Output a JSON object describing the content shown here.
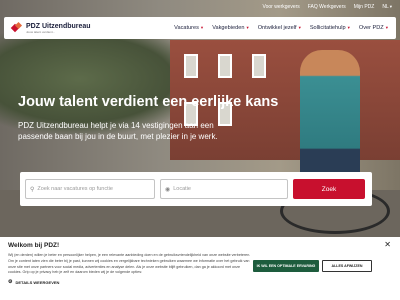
{
  "utility": {
    "links": [
      "Voor werkgevers",
      "FAQ Werkgevers",
      "Mijn PDZ"
    ],
    "language": "NL"
  },
  "brand": {
    "name": "PDZ Uitzendbureau",
    "tagline": "Jouw talent verdient..."
  },
  "nav": {
    "items": [
      "Vacatures",
      "Vakgebieden",
      "Ontwikkel jezelf",
      "Sollicitatiehulp",
      "Over PDZ"
    ]
  },
  "hero": {
    "headline": "Jouw talent verdient een eerlijke kans",
    "subline": "PDZ Uitzendbureau helpt je via 14 vestigingen aan een passende baan bij jou in de buurt, met plezier in je werk."
  },
  "search": {
    "query_placeholder": "Zoek naar vacatures op functie",
    "location_placeholder": "Locatie",
    "button_label": "Zoek"
  },
  "cookie": {
    "title": "Welkom bij PDZ!",
    "text": "Wij (en derden) willen je beter en persoonlijker helpen, je een relevante aanbieding doen en de gebruiksvriendelijkheid van onze website verbeteren. Om je content laten zien die beter bij je past, kunnen wij cookies en vergelijkbare technieken gebruiken waarmee we informatie over het gebruik van onze site met onze partners voor social media, advertenties en analyse delen. Als je onze website blijft gebruiken, dan ga je akkoord met onze cookies. Grip op je privacy heb je zelf en daarom bieden wij je de volgende opties:",
    "details_label": "DETAILS WEERGEVEN",
    "accept_label": "IK WIL EEN OPTIMALE ERVARING",
    "reject_label": "ALLES AFWIJZEN",
    "close_glyph": "✕"
  },
  "colors": {
    "brand_red": "#c8102e",
    "accept_green": "#1d5c3d",
    "navy": "#1b1f3b"
  },
  "icons": {
    "search": "search-icon",
    "location": "location-pin-icon",
    "gear": "gear-icon",
    "chevron": "chevron-down-icon"
  }
}
